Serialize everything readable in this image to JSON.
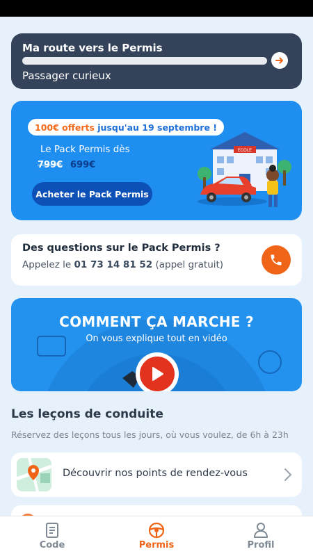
{
  "route": {
    "title": "Ma route vers le Permis",
    "subtitle": "Passager curieux",
    "progress": 0
  },
  "promo": {
    "badge_offer": "100€ offerts",
    "badge_until": " jusqu'au 19 septembre !",
    "pack_label": "Le Pack Permis dès",
    "old_price": "799€",
    "new_price": "699€",
    "buy_button": "Acheter le Pack Permis",
    "illustration_sign": "ECOLE"
  },
  "contact": {
    "question": "Des questions sur le Pack Permis ?",
    "call_prefix": "Appelez le ",
    "phone_number": "01 73 14 81 52",
    "call_suffix": " (appel gratuit)"
  },
  "video": {
    "title": "COMMENT ÇA MARCHE ?",
    "subtitle": "On vous explique tout en vidéo"
  },
  "lessons": {
    "title": "Les leçons de conduite",
    "subtitle": "Réservez des leçons tous les jours, où vous voulez, de 6h à 23h",
    "cards": [
      {
        "label": "Découvrir nos points de rendez-vous"
      },
      {
        "label": ""
      }
    ]
  },
  "nav": {
    "items": [
      {
        "label": "Code",
        "icon": "book-icon"
      },
      {
        "label": "Permis",
        "icon": "steering-wheel-icon"
      },
      {
        "label": "Profil",
        "icon": "user-icon"
      }
    ],
    "active": "Permis"
  },
  "colors": {
    "accent": "#f06417",
    "primary": "#1e8ef0",
    "dark": "#34435a"
  }
}
